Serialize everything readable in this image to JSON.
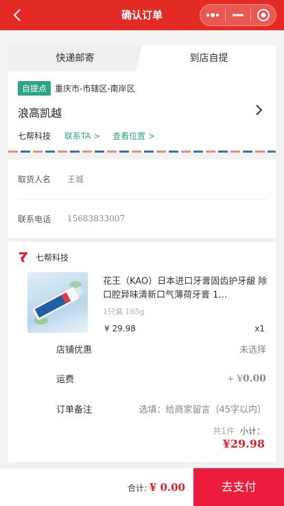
{
  "header": {
    "title": "确认订单"
  },
  "tabs": [
    {
      "label": "快递邮寄"
    },
    {
      "label": "到店自提"
    }
  ],
  "pickup": {
    "badge": "自提点",
    "region": "重庆市-市辖区-南岸区",
    "store_name": "浪高凯越",
    "shop_name": "七帮科技",
    "contact_link": "联系TA >",
    "location_link": "查看位置 >"
  },
  "receiver": {
    "name_label": "取货人名",
    "name_value": "王城",
    "phone_label": "联系电话",
    "phone_value": "15683833007"
  },
  "order": {
    "shop_name": "七帮科技",
    "product": {
      "name": "花王（KAO）日本进口牙膏固齿护牙龈 除口腔异味清新口气薄荷牙膏 1…",
      "spec": "1只装 165g",
      "price": "¥  29.98",
      "quantity": "x1"
    },
    "store_discount_label": "店铺优惠",
    "store_discount_value": "未选择",
    "shipping_label": "运费",
    "shipping_prefix": "+ ¥",
    "shipping_value": "0.00",
    "note_label": "订单备注",
    "note_placeholder": "选填：给商家留言（45字以内）",
    "count_text": "共1件",
    "subtotal_label": "小计：",
    "subtotal_value": "¥29.98"
  },
  "footer": {
    "total_label": "合计:",
    "total_value": "¥ 0.00",
    "pay_button": "去支付"
  },
  "colors": {
    "brand_red": "#e42a24",
    "accent_green": "#2aa585",
    "price_red": "#e0202c",
    "pay_button": "#ee1c3c"
  }
}
